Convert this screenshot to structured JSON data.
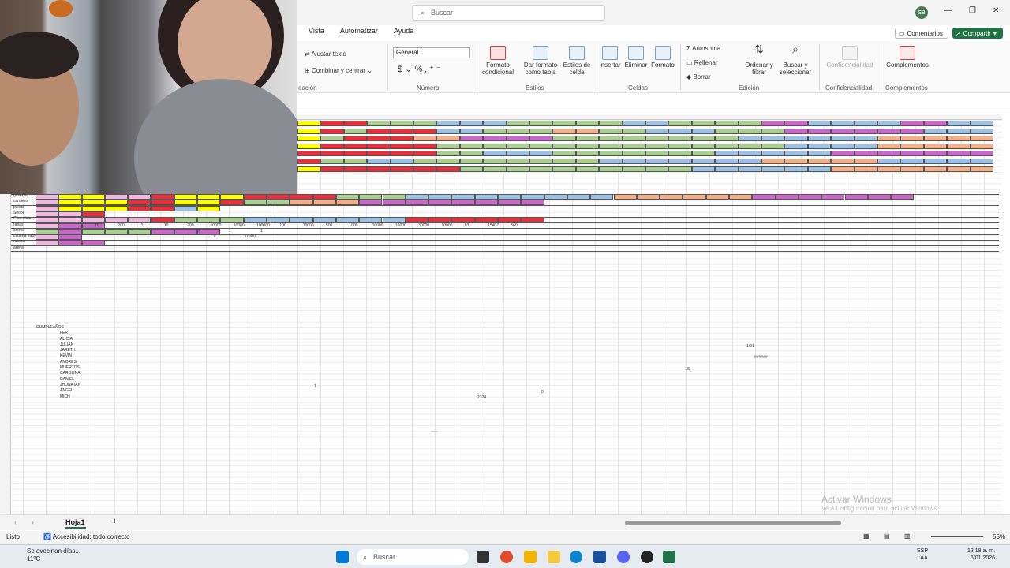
{
  "titlebar": {
    "search_placeholder": "Buscar",
    "user_initials": "SB",
    "minimize": "—",
    "restore": "❐",
    "close": "✕"
  },
  "tabs": [
    "Vista",
    "Automatizar",
    "Ayuda"
  ],
  "header_buttons": {
    "comments": "Comentarios",
    "share": "Compartir"
  },
  "ribbon": {
    "alignment": {
      "wrap": "Ajustar texto",
      "merge": "Combinar y centrar",
      "group": "eación"
    },
    "number": {
      "format": "General",
      "group": "Número"
    },
    "styles": {
      "conditional": "Formato condicional",
      "table": "Dar formato como tabla",
      "cellstyles": "Estilos de celda",
      "group": "Estilos"
    },
    "cells": {
      "insert": "Insertar",
      "delete": "Eliminar",
      "format": "Formato",
      "group": "Celdas"
    },
    "editing": {
      "autosum": "Autosuma",
      "fill": "Rellenar",
      "clear": "Borrar",
      "sort": "Ordenar y filtrar",
      "find": "Buscar y seleccionar",
      "group": "Edición"
    },
    "sensitivity": {
      "label": "Confidencialidad",
      "group": "Confidencialidad"
    },
    "addins": {
      "label": "Complementos",
      "group": "Complementos"
    }
  },
  "sheet": {
    "names_header": "CUMPLEAÑOS",
    "names": [
      "FER",
      "ALICIA",
      "JULIAN",
      "JARETH",
      "KEVIN",
      "ANDRES",
      "MUERTOS",
      "CAROLINA",
      "DANIEL",
      "JHONATAN",
      "ANGEL",
      "MICH"
    ],
    "row_labels": [
      "gaseosa",
      "cardeno",
      "paleta",
      "Sirope",
      "Chocolate",
      "ranas",
      "crema",
      "cadena gato",
      "ratonar",
      "arena"
    ],
    "numbers": [
      "10",
      "200",
      "1",
      "10",
      "200",
      "10000",
      "10000",
      "100000",
      "100",
      "10000",
      "500",
      "1000",
      "10000",
      "10000",
      "30000",
      "10000",
      "83",
      "15407",
      "560",
      "5",
      "1",
      "1",
      "10000",
      "1"
    ],
    "misc": {
      "t1": "1/8",
      "t2": "1/01",
      "t3": "######",
      "t4": "1",
      "t5": "2324",
      "t6": "0",
      "t7": "~~~"
    }
  },
  "watermark": {
    "line1": "Activar Windows",
    "line2": "Ve a Configuración para activar Windows."
  },
  "sheet_tabs": {
    "active": "Hoja1",
    "add": "+"
  },
  "statusbar": {
    "ready": "Listo",
    "accessibility": "Accesibilidad: todo correcto",
    "zoom": "55%"
  },
  "taskbar": {
    "weather_line1": "Se avecinan días...",
    "weather_line2": "11°C",
    "search": "Buscar",
    "lang1": "ESP",
    "lang2": "LAA",
    "time": "12:18 a. m.",
    "date": "6/01/2026"
  },
  "colors": {
    "excel_green": "#217346",
    "yellow": "#ffff00",
    "red": "#e8303a",
    "green": "#a9d08e",
    "blue": "#9bc2e6",
    "purple": "#cc66cc"
  }
}
